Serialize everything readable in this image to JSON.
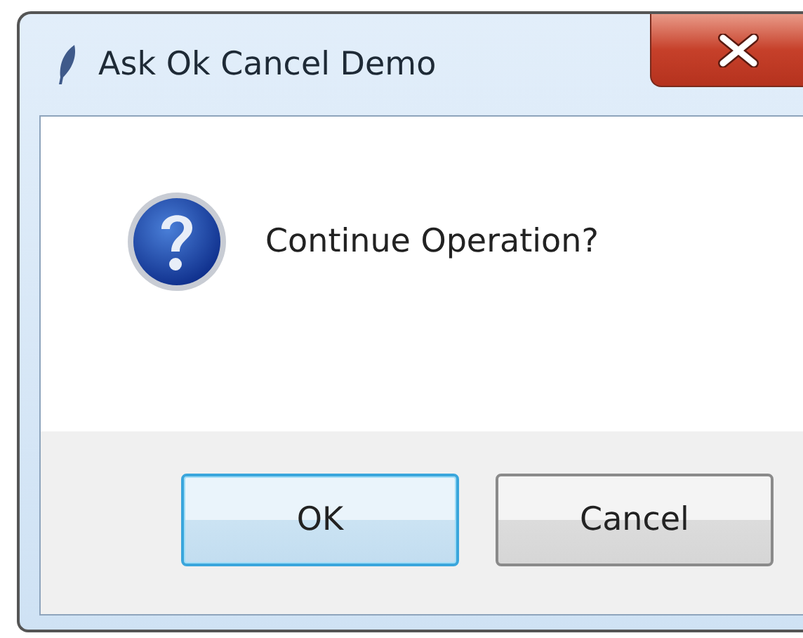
{
  "window": {
    "title": "Ask Ok Cancel Demo"
  },
  "message": "Continue Operation?",
  "buttons": [
    {
      "label": "OK",
      "default": true
    },
    {
      "label": "Cancel",
      "default": false
    }
  ]
}
